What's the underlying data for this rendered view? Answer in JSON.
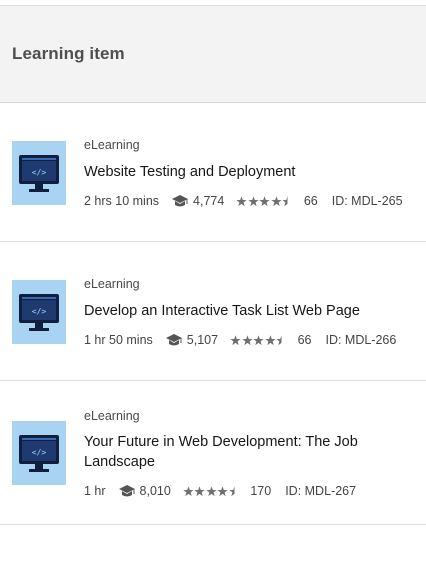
{
  "header": {
    "title": "Learning item"
  },
  "colors": {
    "thumbnail_bg": "#a9d3f3",
    "monitor": "#0f1f3d",
    "star": "#6f6f6f",
    "header_bg": "#f3f3f3"
  },
  "items": [
    {
      "type": "eLearning",
      "title": "Website Testing and Deployment",
      "duration": "2 hrs 10 mins",
      "learners": "4,774",
      "rating_stars": 4.5,
      "ratings_count": "66",
      "id": "ID: MDL-265",
      "thumbnail_icon": "code-monitor-icon"
    },
    {
      "type": "eLearning",
      "title": "Develop an Interactive Task List Web Page",
      "duration": "1 hr 50 mins",
      "learners": "5,107",
      "rating_stars": 4.5,
      "ratings_count": "66",
      "id": "ID: MDL-266",
      "thumbnail_icon": "code-monitor-icon"
    },
    {
      "type": "eLearning",
      "title": "Your Future in Web Development: The Job Landscape",
      "duration": "1 hr",
      "learners": "8,010",
      "rating_stars": 4.5,
      "ratings_count": "170",
      "id": "ID: MDL-267",
      "thumbnail_icon": "code-monitor-icon"
    }
  ]
}
